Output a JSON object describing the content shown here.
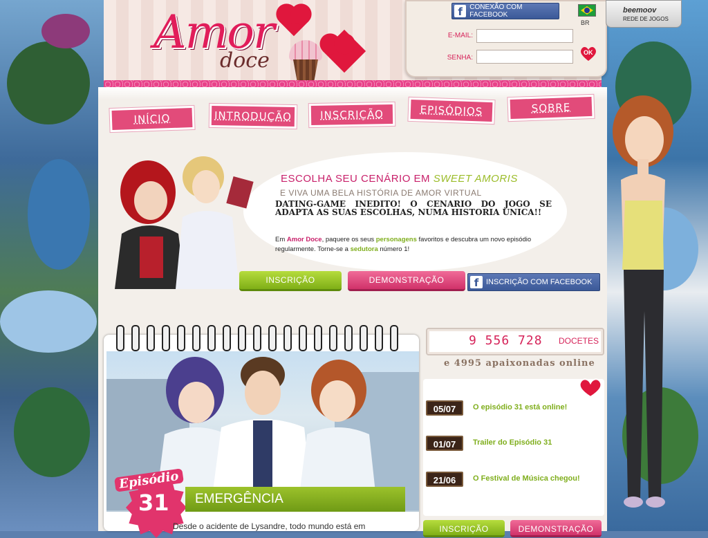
{
  "logo": {
    "amor": "Amor",
    "doce": "doce"
  },
  "login": {
    "facebook_connect": "CONEXÃO COM FACEBOOK",
    "email_label": "E-MAIL:",
    "email_value": "",
    "password_label": "SENHA:",
    "password_value": "",
    "ok_label": "OK",
    "language": "BR"
  },
  "network": {
    "brand": "beemoov",
    "label": "REDE DE JOGOS"
  },
  "nav": [
    "INÍCIO",
    "INTRODUÇÃO",
    "INSCRIÇÃO",
    "EPISÓDIOS",
    "SOBRE"
  ],
  "promo": {
    "headline_prefix": "ESCOLHA SEU CENÁRIO EM ",
    "headline_highlight": "SWEET AMORIS",
    "subheadline": "E VIVA UMA BELA HISTÓRIA DE AMOR VIRTUAL",
    "tagline": "DATING-GAME INEDITO! O CENARIO DO JOGO SE ADAPTA AS SUAS ESCOLHAS, NUMA HISTORIA UNICA!!",
    "body_1": "Em ",
    "body_brand": "Amor Doce",
    "body_2": ", paquere os seus ",
    "body_chars": "personagens",
    "body_3": " favoritos e descubra um novo episódio regularmente. Torne-se a ",
    "body_seductress": "sedutora",
    "body_4": " número 1!",
    "signup_button": "INSCRIÇÃO",
    "demo_button": "DEMONSTRAÇÃO",
    "facebook_signup": "INSCRIÇÃO COM FACEBOOK"
  },
  "episode": {
    "label": "Episódio",
    "number": "31",
    "title": "EMERGÊNCIA",
    "teaser": "Desde o acidente de Lysandre, todo mundo está em"
  },
  "stats": {
    "count": "9 556 728",
    "unit": "DOCETES",
    "online": "e 4995 apaixonadas online"
  },
  "news": [
    {
      "date": "05/07",
      "title": "O episódio 31 está online!"
    },
    {
      "date": "01/07",
      "title": "Trailer do Episódio 31"
    },
    {
      "date": "21/06",
      "title": "O Festival de Música chegou!"
    }
  ],
  "bottom_buttons": {
    "signup": "INSCRIÇÃO",
    "demo": "DEMONSTRAÇÃO"
  },
  "colors": {
    "brand_pink": "#e1346c",
    "accent_green": "#7fae1c",
    "facebook": "#3b5998"
  }
}
